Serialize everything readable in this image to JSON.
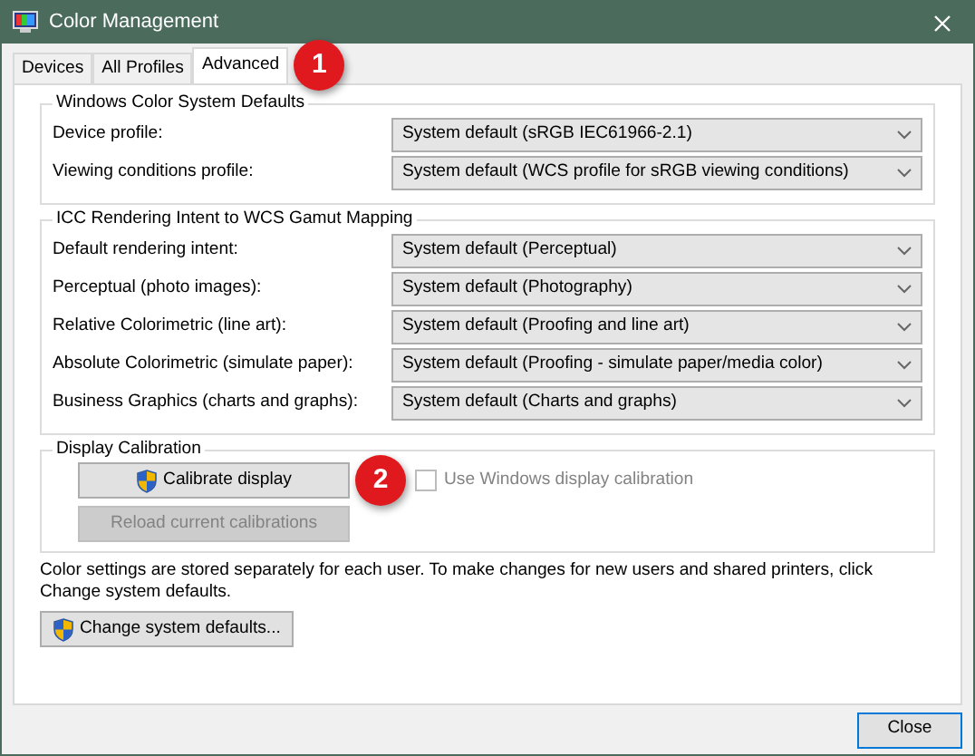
{
  "window": {
    "title": "Color Management"
  },
  "tabs": [
    {
      "label": "Devices",
      "selected": false
    },
    {
      "label": "All Profiles",
      "selected": false
    },
    {
      "label": "Advanced",
      "selected": true
    }
  ],
  "groups": [
    {
      "title": "Windows Color System Defaults",
      "rows": [
        {
          "label": "Device profile:",
          "value": "System default (sRGB IEC61966-2.1)"
        },
        {
          "label": "Viewing conditions profile:",
          "value": "System default (WCS profile for sRGB viewing conditions)"
        }
      ]
    },
    {
      "title": "ICC Rendering Intent to WCS Gamut Mapping",
      "rows": [
        {
          "label": "Default rendering intent:",
          "value": "System default (Perceptual)"
        },
        {
          "label": "Perceptual (photo images):",
          "value": "System default (Photography)"
        },
        {
          "label": "Relative Colorimetric (line art):",
          "value": "System default (Proofing and line art)"
        },
        {
          "label": "Absolute Colorimetric (simulate paper):",
          "value": "System default (Proofing - simulate paper/media color)"
        },
        {
          "label": "Business Graphics (charts and graphs):",
          "value": "System default (Charts and graphs)"
        }
      ]
    }
  ],
  "calibration": {
    "title": "Display Calibration",
    "calibrate_button": {
      "label": "Calibrate display",
      "disabled": false
    },
    "reload_button": {
      "label": "Reload current calibrations",
      "disabled": true
    },
    "use_windows_calibration": {
      "label": "Use Windows display calibration",
      "checked": false,
      "disabled": true
    }
  },
  "note": "Color settings are stored separately for each user. To make changes for new users and shared printers, click Change system defaults.",
  "change_defaults_button": {
    "label": "Change system defaults..."
  },
  "close_button": {
    "label": "Close"
  },
  "callouts": [
    {
      "number": "1"
    },
    {
      "number": "2"
    }
  ]
}
